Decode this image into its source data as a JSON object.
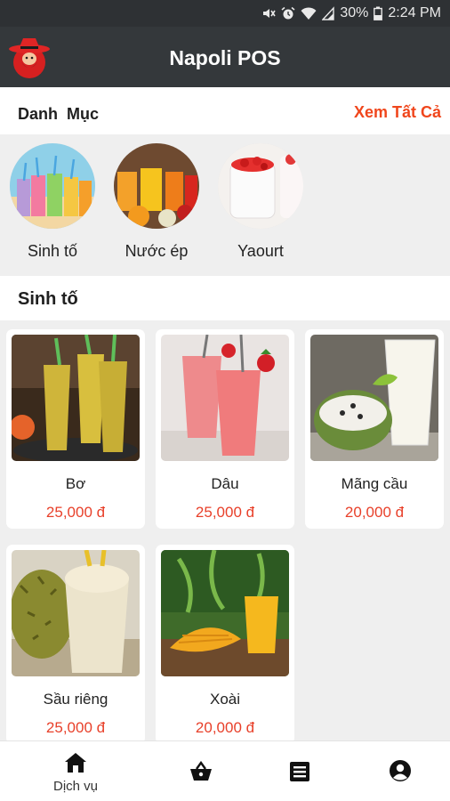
{
  "status_bar": {
    "battery": "30%",
    "time": "2:24 PM"
  },
  "app_bar": {
    "title": "Napoli POS"
  },
  "categories": {
    "heading": "Danh  Mục",
    "see_all": "Xem Tất Cả",
    "items": [
      {
        "name": "Sinh tố"
      },
      {
        "name": "Nước ép"
      },
      {
        "name": "Yaourt"
      }
    ]
  },
  "section": {
    "title": "Sinh tố"
  },
  "products": [
    {
      "name": "Bơ",
      "price": "25,000 đ"
    },
    {
      "name": "Dâu",
      "price": "25,000 đ"
    },
    {
      "name": "Mãng cầu",
      "price": "20,000 đ"
    },
    {
      "name": "Sầu riêng",
      "price": "25,000 đ"
    },
    {
      "name": "Xoài",
      "price": "20,000 đ"
    }
  ],
  "bottom_nav": {
    "items": [
      {
        "icon": "home-icon",
        "label": "Dịch vụ"
      },
      {
        "icon": "basket-icon"
      },
      {
        "icon": "list-icon"
      },
      {
        "icon": "account-icon"
      }
    ]
  },
  "colors": {
    "accent": "#f0461c",
    "price": "#e8402a",
    "app_bar": "#34383b",
    "status_bar": "#2e3134"
  }
}
